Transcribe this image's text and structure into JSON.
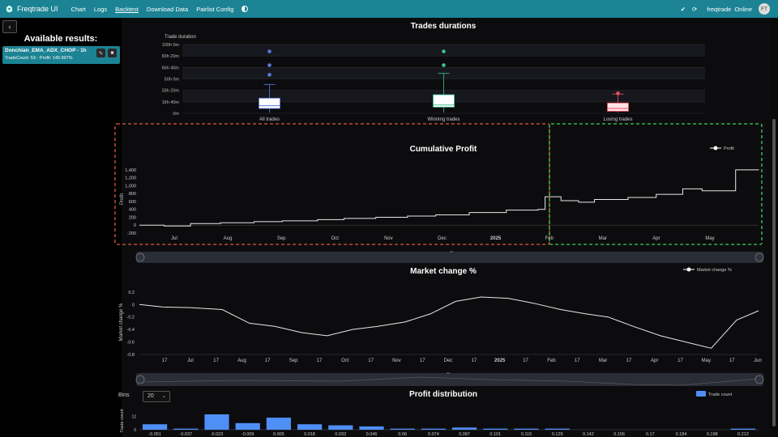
{
  "topbar": {
    "brand": "Freqtrade UI",
    "nav": [
      "Chart",
      "Logs",
      "Backtest",
      "Download Data",
      "Pairlist Config"
    ],
    "active_nav": "Backtest",
    "bot_name": "freqtrade",
    "status": "Online",
    "avatar": "FT",
    "icons": [
      "freqtrade-logo-icon",
      "moon-icon",
      "check-icon",
      "refresh-icon"
    ]
  },
  "sidebar": {
    "back": "‹",
    "title": "Available results:",
    "result": {
      "name": "Donchian_EMA_ADX_CHOP - 1h",
      "summary": "TradeCount: 53 - Profit: 140.997%"
    }
  },
  "colors": {
    "accent": "#1b8394",
    "all": "#5b7be0",
    "win": "#3cc48a",
    "lose": "#ee5060",
    "bars": "#4f8ef7"
  },
  "chart_data": [
    {
      "type": "boxplot",
      "title": "Trades durations",
      "ylabel": "Trade duration",
      "y_ticks": [
        "100h 0m",
        "83h 20m",
        "66h 40m",
        "50h 0m",
        "33h 20m",
        "16h 40m",
        "0m"
      ],
      "ylim_hours": [
        0,
        100
      ],
      "categories": [
        "All trades",
        "Winning trades",
        "Losing trades"
      ],
      "boxes": [
        {
          "q1": 7,
          "median": 11,
          "q3": 22,
          "whisker_low": 1,
          "whisker_high": 42,
          "outliers": [
            56,
            70,
            90
          ]
        },
        {
          "q1": 9,
          "median": 12,
          "q3": 27,
          "whisker_low": 1,
          "whisker_high": 58,
          "outliers": [
            70,
            90
          ]
        },
        {
          "q1": 3,
          "median": 7,
          "q3": 15,
          "whisker_low": 1,
          "whisker_high": 28,
          "outliers": [
            29
          ]
        }
      ]
    },
    {
      "type": "line",
      "title": "Cumulative Profit",
      "ylabel": "Profit",
      "legend": "Profit",
      "y_ticks": [
        -200,
        0,
        200,
        400,
        600,
        800,
        1000,
        1200,
        1400
      ],
      "ylim": [
        -200,
        1500
      ],
      "x_ticks": [
        "Jul",
        "Aug",
        "Sep",
        "Oct",
        "Nov",
        "Dec",
        "2025",
        "Feb",
        "Mar",
        "Apr",
        "May"
      ],
      "x_range": [
        "2024-06-16",
        "2025-06-02"
      ],
      "x": [
        "2024-06-16",
        "2024-06-30",
        "2024-07-15",
        "2024-08-01",
        "2024-08-20",
        "2024-09-05",
        "2024-09-25",
        "2024-10-10",
        "2024-10-28",
        "2024-11-15",
        "2024-12-01",
        "2024-12-20",
        "2025-01-10",
        "2025-01-28",
        "2025-02-01",
        "2025-02-10",
        "2025-02-20",
        "2025-03-01",
        "2025-03-20",
        "2025-04-05",
        "2025-04-20",
        "2025-05-01",
        "2025-05-20",
        "2025-06-02"
      ],
      "y": [
        0,
        -20,
        40,
        60,
        90,
        110,
        140,
        170,
        200,
        230,
        260,
        320,
        380,
        400,
        720,
        620,
        580,
        650,
        700,
        780,
        920,
        870,
        1400,
        1390
      ]
    },
    {
      "type": "line",
      "title": "Market change %",
      "ylabel": "Market change %",
      "legend": "Market change %",
      "y_ticks": [
        0.2,
        0,
        -0.2,
        -0.4,
        -0.6,
        -0.8
      ],
      "ylim": [
        -0.8,
        0.25
      ],
      "x_ticks": [
        "17",
        "Jul",
        "17",
        "Aug",
        "17",
        "Sep",
        "17",
        "Oct",
        "17",
        "Nov",
        "17",
        "Dec",
        "17",
        "2025",
        "17",
        "Feb",
        "17",
        "Mar",
        "17",
        "Apr",
        "17",
        "May",
        "17",
        "Jun"
      ],
      "x_range": [
        "2024-06-01",
        "2025-06-02"
      ],
      "x": [
        "2024-06-01",
        "2024-06-15",
        "2024-07-01",
        "2024-07-20",
        "2024-08-05",
        "2024-08-20",
        "2024-09-05",
        "2024-09-20",
        "2024-10-05",
        "2024-10-20",
        "2024-11-05",
        "2024-11-20",
        "2024-12-05",
        "2024-12-20",
        "2025-01-05",
        "2025-01-20",
        "2025-02-05",
        "2025-02-20",
        "2025-03-05",
        "2025-03-20",
        "2025-04-05",
        "2025-04-20",
        "2025-05-05",
        "2025-05-20",
        "2025-06-02"
      ],
      "y": [
        0.0,
        -0.04,
        -0.05,
        -0.08,
        -0.3,
        -0.35,
        -0.45,
        -0.5,
        -0.4,
        -0.35,
        -0.28,
        -0.15,
        0.05,
        0.12,
        0.1,
        0.02,
        -0.08,
        -0.15,
        -0.2,
        -0.35,
        -0.5,
        -0.6,
        -0.7,
        -0.25,
        -0.1
      ]
    },
    {
      "type": "bar",
      "title": "Profit distribution",
      "ylabel": "Trade count",
      "legend": "Trade count",
      "bins_label": "Bins",
      "bins_value": "20",
      "y_ticks": [
        0,
        12
      ],
      "ylim": [
        0,
        14
      ],
      "categories": [
        "-0.051",
        "-0.037",
        "-0.023",
        "-0.009",
        "0.005",
        "0.018",
        "0.032",
        "0.046",
        "0.06",
        "0.074",
        "0.087",
        "0.101",
        "0.115",
        "0.129",
        "0.142",
        "0.156",
        "0.17",
        "0.184",
        "0.198",
        "0.212"
      ],
      "values": [
        5,
        1,
        14,
        6,
        11,
        5,
        4,
        3,
        1,
        1,
        2,
        1,
        1,
        1,
        0,
        0,
        0,
        0,
        0,
        1
      ]
    }
  ]
}
